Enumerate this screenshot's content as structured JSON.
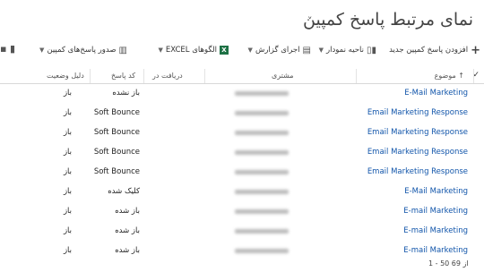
{
  "page": {
    "title": "نمای مرتبط پاسخ کمپین",
    "chevron": "˅"
  },
  "toolbar": {
    "new_label": "افزودن پاسخ کمپین جدید",
    "chart_label": "ناحیه نمودار",
    "report_label": "اجرای گزارش",
    "excel_label": "الگوهای EXCEL",
    "export_label": "صدور پاسخ‌های کمپین"
  },
  "columns": {
    "subject": "موضوع ↑",
    "customer": "مشتری",
    "received": "دریافت در",
    "code": "کد پاسخ",
    "status": "دلیل وضعیت"
  },
  "rows": [
    {
      "subject": "E-Mail Marketing",
      "code": "باز نشده",
      "status": "باز"
    },
    {
      "subject": "Email Marketing Response",
      "code": "Soft Bounce",
      "status": "باز"
    },
    {
      "subject": "Email Marketing Response",
      "code": "Soft Bounce",
      "status": "باز"
    },
    {
      "subject": "Email Marketing Response",
      "code": "Soft Bounce",
      "status": "باز"
    },
    {
      "subject": "Email Marketing Response",
      "code": "Soft Bounce",
      "status": "باز"
    },
    {
      "subject": "E-Mail Marketing",
      "code": "کلیک شده",
      "status": "باز"
    },
    {
      "subject": "E-mail Marketing",
      "code": "باز شده",
      "status": "باز"
    },
    {
      "subject": "E-mail Marketing",
      "code": "باز شده",
      "status": "باز"
    },
    {
      "subject": "E-mail Marketing",
      "code": "باز شده",
      "status": "باز"
    }
  ],
  "footer": {
    "range": "1 - 50 از 69"
  }
}
